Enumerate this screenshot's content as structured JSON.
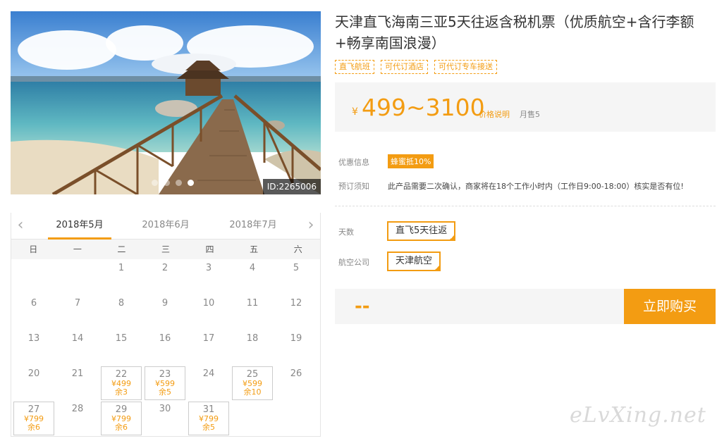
{
  "gallery": {
    "id_label": "ID:2265006",
    "dots": 4,
    "active_dot": 3
  },
  "calendar": {
    "months": [
      "2018年5月",
      "2018年6月",
      "2018年7月"
    ],
    "active_month": 0,
    "weekdays": [
      "日",
      "一",
      "二",
      "三",
      "四",
      "五",
      "六"
    ],
    "leading_blanks": 2,
    "days": [
      {
        "d": "1"
      },
      {
        "d": "2"
      },
      {
        "d": "3"
      },
      {
        "d": "4"
      },
      {
        "d": "5"
      },
      {
        "d": "6"
      },
      {
        "d": "7"
      },
      {
        "d": "8"
      },
      {
        "d": "9"
      },
      {
        "d": "10"
      },
      {
        "d": "11"
      },
      {
        "d": "12"
      },
      {
        "d": "13"
      },
      {
        "d": "14"
      },
      {
        "d": "15"
      },
      {
        "d": "16"
      },
      {
        "d": "17"
      },
      {
        "d": "18"
      },
      {
        "d": "19"
      },
      {
        "d": "20"
      },
      {
        "d": "21"
      },
      {
        "d": "22",
        "price": "¥499",
        "stock": "余3"
      },
      {
        "d": "23",
        "price": "¥599",
        "stock": "余5"
      },
      {
        "d": "24"
      },
      {
        "d": "25",
        "price": "¥599",
        "stock": "余10"
      },
      {
        "d": "26"
      },
      {
        "d": "27",
        "price": "¥799",
        "stock": "余6"
      },
      {
        "d": "28"
      },
      {
        "d": "29",
        "price": "¥799",
        "stock": "余6"
      },
      {
        "d": "30"
      },
      {
        "d": "31",
        "price": "¥799",
        "stock": "余5"
      }
    ]
  },
  "product": {
    "title": "天津直飞海南三亚5天往返含税机票（优质航空+含行李额+畅享南国浪漫）",
    "tags": [
      "直飞航班",
      "可代订酒店",
      "可代订专车接送"
    ],
    "price_symbol": "¥",
    "price_range": "499~3100",
    "price_explain": "价格说明",
    "monthly_sold": "月售5"
  },
  "info": {
    "promo_label": "优惠信息",
    "promo_badge": "蜂蜜抵10%",
    "notice_label": "预订须知",
    "notice_text": "此产品需要二次确认，商家将在18个工作小时内（工作日9:00-18:00）核实是否有位!"
  },
  "options": {
    "days_label": "天数",
    "days_value": "直飞5天往返",
    "airline_label": "航空公司",
    "airline_value": "天津航空"
  },
  "purchase": {
    "total": "--",
    "buy_label": "立即购买"
  },
  "watermark": "eLvXing.net",
  "colors": {
    "accent": "#f39c12",
    "panel_bg": "#f5f5f5"
  }
}
